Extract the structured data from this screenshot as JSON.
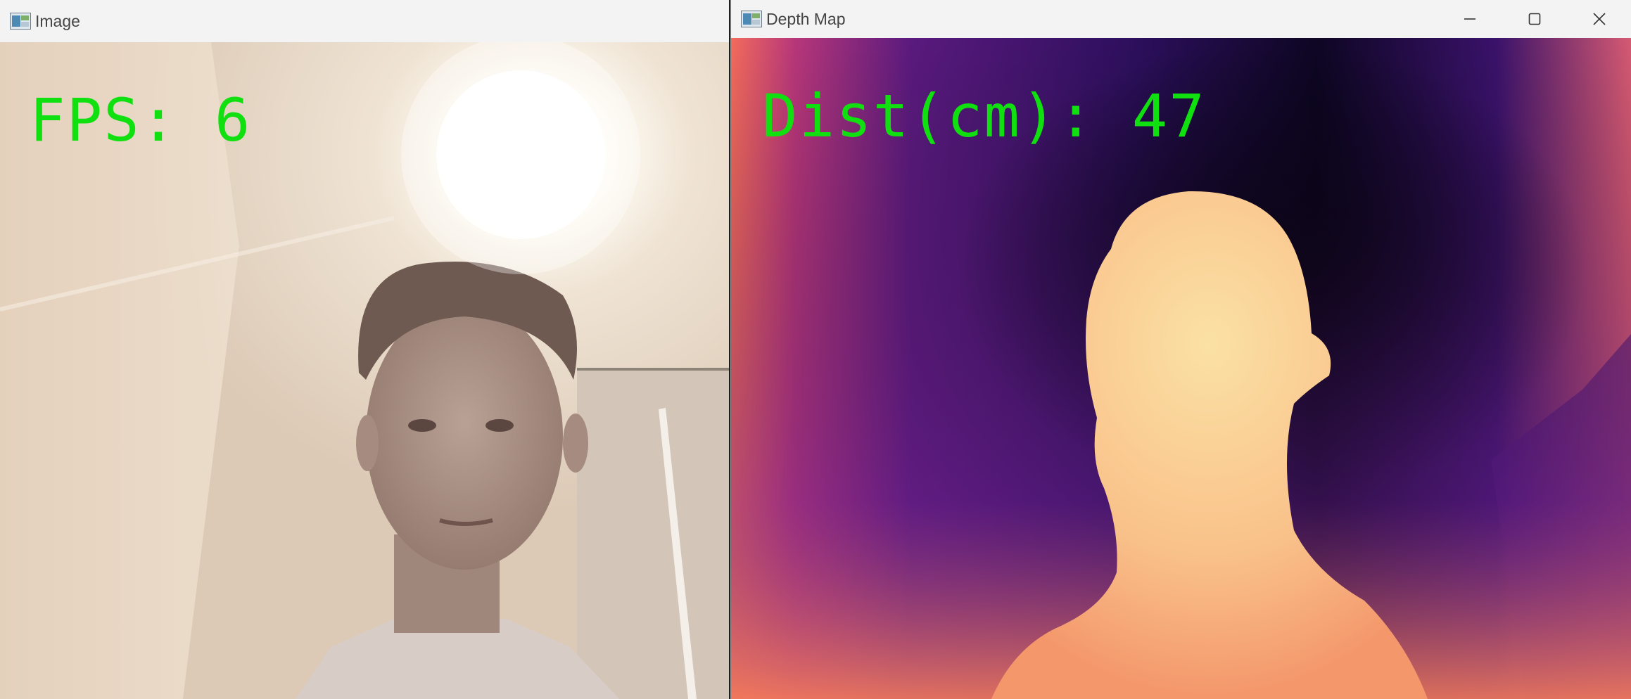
{
  "image_window": {
    "title": "Image",
    "icon": "opencv-window-icon",
    "overlay": {
      "label": "FPS:",
      "value": "6"
    }
  },
  "depth_window": {
    "title": "Depth Map",
    "icon": "opencv-window-icon",
    "controls": [
      "minimize-icon",
      "maximize-icon",
      "close-icon"
    ],
    "overlay": {
      "label": "Dist(cm):",
      "value": "47"
    }
  },
  "colors": {
    "overlay_text": "#10e010",
    "depth_near": "#f8d8a0",
    "depth_far": "#0c0620"
  }
}
